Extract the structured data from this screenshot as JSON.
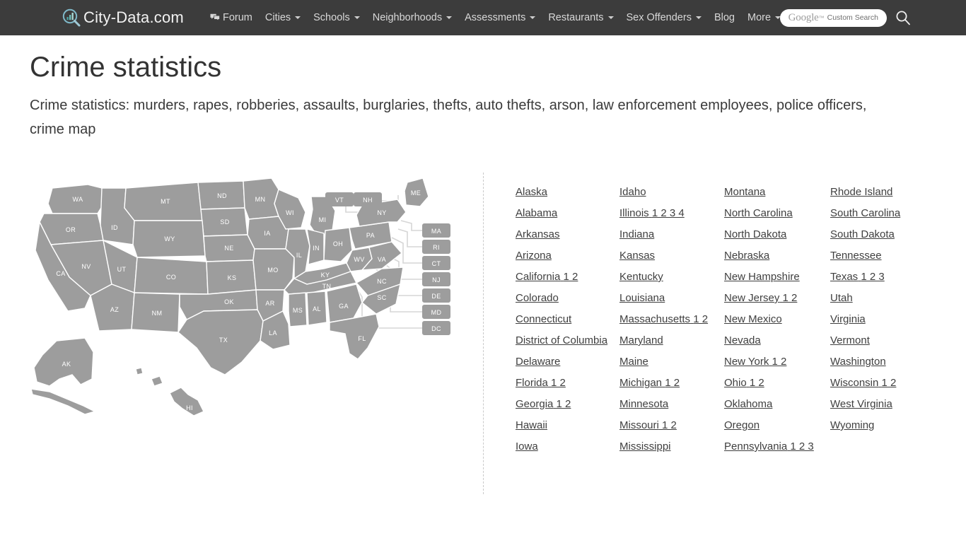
{
  "header": {
    "brand": "City-Data.com",
    "logo_icon": "magnifier-chart-logo",
    "nav": [
      {
        "label": "Forum",
        "icon": "comment-bubble-icon",
        "caret": false
      },
      {
        "label": "Cities",
        "icon": null,
        "caret": true
      },
      {
        "label": "Schools",
        "icon": null,
        "caret": true
      },
      {
        "label": "Neighborhoods",
        "icon": null,
        "caret": true
      },
      {
        "label": "Assessments",
        "icon": null,
        "caret": true
      },
      {
        "label": "Restaurants",
        "icon": null,
        "caret": true
      },
      {
        "label": "Sex Offenders",
        "icon": null,
        "caret": true
      },
      {
        "label": "Blog",
        "icon": null,
        "caret": false
      },
      {
        "label": "More",
        "icon": null,
        "caret": true
      }
    ],
    "search": {
      "google_word": "Google",
      "trademark": "™",
      "custom_search_label": "Custom Search",
      "submit_icon": "search-icon"
    },
    "background_color": "#3c3c3c",
    "text_color": "#d8d8d8"
  },
  "page": {
    "title": "Crime statistics",
    "subtitle": "Crime statistics: murders, rapes, robberies, assaults, burglaries, thefts, auto thefts, arson, law enforcement employees, police officers, crime map"
  },
  "map": {
    "fill_color": "#9d9d9d",
    "stroke_color": "#ffffff",
    "label_color": "#ffffff",
    "leader_line_color": "#d6d6d6",
    "inline_labels": [
      "WA",
      "OR",
      "ID",
      "MT",
      "ND",
      "SD",
      "MN",
      "WI",
      "MI",
      "NY",
      "ME",
      "WY",
      "NE",
      "IA",
      "IL",
      "IN",
      "OH",
      "PA",
      "NV",
      "UT",
      "CO",
      "KS",
      "MO",
      "KY",
      "WV",
      "VA",
      "CA",
      "AZ",
      "NM",
      "OK",
      "AR",
      "TN",
      "NC",
      "SC",
      "MS",
      "AL",
      "GA",
      "LA",
      "TX",
      "FL",
      "AK",
      "HI"
    ],
    "callout_labels": [
      "VT",
      "NH",
      "MA",
      "RI",
      "CT",
      "NJ",
      "DE",
      "MD",
      "DC"
    ]
  },
  "state_list": {
    "columns": [
      [
        {
          "name": "Alaska",
          "pages": ""
        },
        {
          "name": "Alabama",
          "pages": ""
        },
        {
          "name": "Arkansas",
          "pages": ""
        },
        {
          "name": "Arizona",
          "pages": ""
        },
        {
          "name": "California",
          "pages": "1 2"
        },
        {
          "name": "Colorado",
          "pages": ""
        },
        {
          "name": "Connecticut",
          "pages": ""
        },
        {
          "name": "District of Columbia",
          "pages": ""
        },
        {
          "name": "Delaware",
          "pages": ""
        },
        {
          "name": "Florida",
          "pages": "1 2"
        },
        {
          "name": "Georgia",
          "pages": "1 2"
        },
        {
          "name": "Hawaii",
          "pages": ""
        },
        {
          "name": "Iowa",
          "pages": ""
        }
      ],
      [
        {
          "name": "Idaho",
          "pages": ""
        },
        {
          "name": "Illinois",
          "pages": "1 2 3 4"
        },
        {
          "name": "Indiana",
          "pages": ""
        },
        {
          "name": "Kansas",
          "pages": ""
        },
        {
          "name": "Kentucky",
          "pages": ""
        },
        {
          "name": "Louisiana",
          "pages": ""
        },
        {
          "name": "Massachusetts",
          "pages": "1 2"
        },
        {
          "name": "Maryland",
          "pages": ""
        },
        {
          "name": "Maine",
          "pages": ""
        },
        {
          "name": "Michigan",
          "pages": "1 2"
        },
        {
          "name": "Minnesota",
          "pages": ""
        },
        {
          "name": "Missouri",
          "pages": "1 2"
        },
        {
          "name": "Mississippi",
          "pages": ""
        }
      ],
      [
        {
          "name": "Montana",
          "pages": ""
        },
        {
          "name": "North Carolina",
          "pages": ""
        },
        {
          "name": "North Dakota",
          "pages": ""
        },
        {
          "name": "Nebraska",
          "pages": ""
        },
        {
          "name": "New Hampshire",
          "pages": ""
        },
        {
          "name": "New Jersey",
          "pages": "1 2"
        },
        {
          "name": "New Mexico",
          "pages": ""
        },
        {
          "name": "Nevada",
          "pages": ""
        },
        {
          "name": "New York",
          "pages": "1 2"
        },
        {
          "name": "Ohio",
          "pages": "1 2"
        },
        {
          "name": "Oklahoma",
          "pages": ""
        },
        {
          "name": "Oregon",
          "pages": ""
        },
        {
          "name": "Pennsylvania",
          "pages": "1 2 3"
        }
      ],
      [
        {
          "name": "Rhode Island",
          "pages": ""
        },
        {
          "name": "South Carolina",
          "pages": ""
        },
        {
          "name": "South Dakota",
          "pages": ""
        },
        {
          "name": "Tennessee",
          "pages": ""
        },
        {
          "name": "Texas",
          "pages": "1 2 3"
        },
        {
          "name": "Utah",
          "pages": ""
        },
        {
          "name": "Virginia",
          "pages": ""
        },
        {
          "name": "Vermont",
          "pages": ""
        },
        {
          "name": "Washington",
          "pages": ""
        },
        {
          "name": "Wisconsin",
          "pages": "1 2"
        },
        {
          "name": "West Virginia",
          "pages": ""
        },
        {
          "name": "Wyoming",
          "pages": ""
        }
      ]
    ]
  }
}
